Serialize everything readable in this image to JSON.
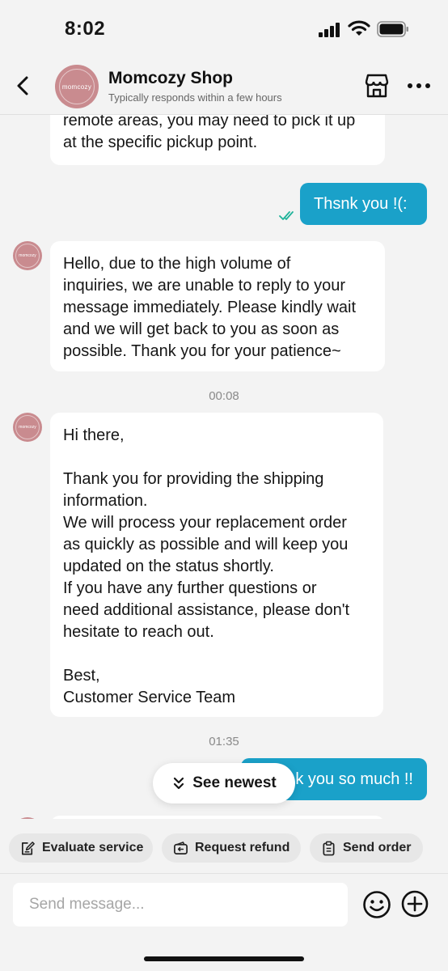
{
  "status_bar": {
    "time": "8:02"
  },
  "header": {
    "shop_name": "Momcozy Shop",
    "response_note": "Typically responds within a few hours",
    "avatar_logo": "momcozy"
  },
  "messages": [
    {
      "from": "shop",
      "lines": [
        "remote areas, you may need to pick it up",
        "at the specific pickup point."
      ]
    },
    {
      "from": "user",
      "lines": [
        "Thsnk you !(:"
      ],
      "status": "read"
    },
    {
      "from": "shop",
      "lines": [
        "Hello, due to the high volume of",
        "inquiries, we are unable to reply to your",
        "message immediately. Please kindly wait",
        "and we will get back to you as soon as",
        "possible. Thank you for your patience~"
      ]
    },
    {
      "timestamp": "00:08"
    },
    {
      "from": "shop",
      "lines": [
        "Hi there,",
        "",
        "Thank you for providing the shipping",
        "information.",
        "We will process your replacement order",
        "as quickly as possible and will keep you",
        "updated on the status shortly.",
        "If you have any further questions or",
        "need additional assistance, please don't",
        "hesitate to reach out.",
        "",
        "Best,",
        "Customer Service Team"
      ]
    },
    {
      "timestamp": "01:35"
    },
    {
      "from": "user",
      "lines": [
        "k you so much !!"
      ]
    }
  ],
  "see_newest": {
    "label": "See newest",
    "icon": "chevrons-down-icon"
  },
  "quick_actions": [
    {
      "label": "Evaluate service",
      "icon": "edit-note-icon"
    },
    {
      "label": "Request refund",
      "icon": "refund-wallet-icon"
    },
    {
      "label": "Send order",
      "icon": "clipboard-icon"
    }
  ],
  "composer": {
    "placeholder": "Send message..."
  },
  "colors": {
    "accent": "#1aa1c9",
    "read_check": "#1fb39a",
    "avatar": "#c98b8f",
    "background": "#f3f3f3"
  }
}
